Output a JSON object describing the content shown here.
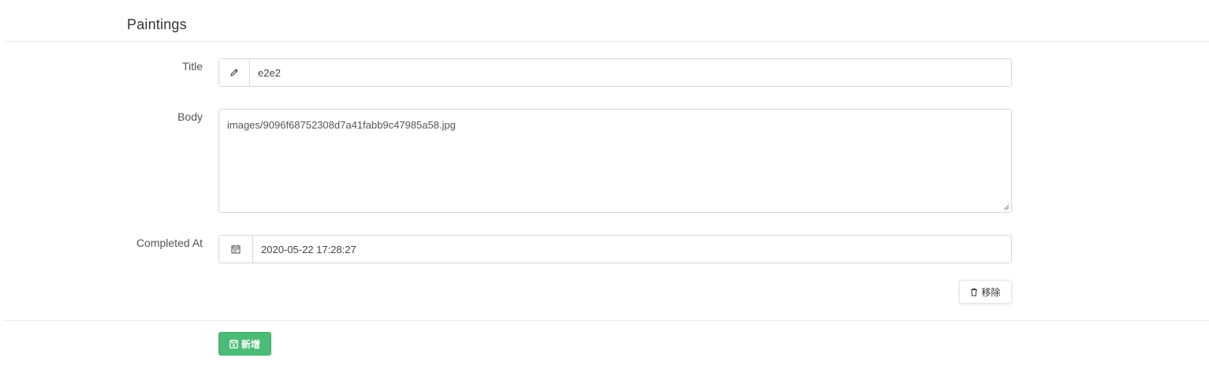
{
  "section": {
    "title": "Paintings"
  },
  "form": {
    "title_field": {
      "label": "Title",
      "value": "e2e2",
      "icon": "pencil-icon"
    },
    "body_field": {
      "label": "Body",
      "value": "images/9096f68752308d7a41fabb9c47985a58.jpg"
    },
    "completed_at_field": {
      "label": "Completed At",
      "value": "2020-05-22 17:28:27",
      "icon": "calendar-icon"
    }
  },
  "buttons": {
    "remove_label": "移除",
    "remove_icon": "trash-icon",
    "add_label": "新增",
    "add_icon": "save-icon"
  },
  "colors": {
    "primary_green": "#4cbb76",
    "border": "#d5d9de"
  }
}
